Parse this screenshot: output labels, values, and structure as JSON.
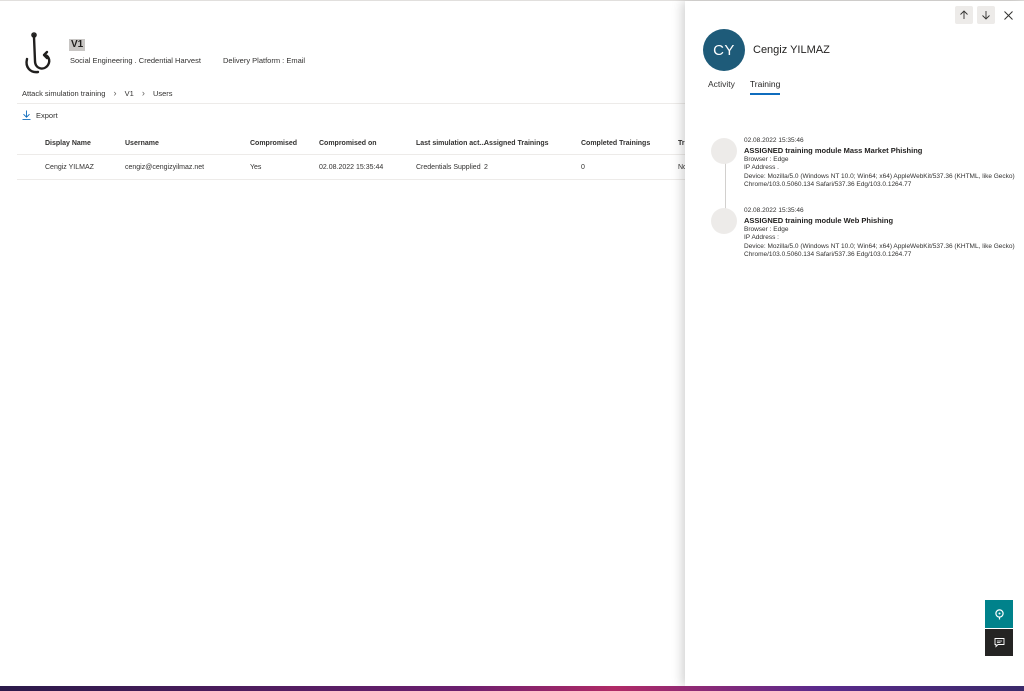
{
  "header": {
    "title": "V1",
    "technique": "Social Engineering . Credential Harvest",
    "platform": "Delivery Platform : Email",
    "logo_icon": "fishing-hook-icon"
  },
  "breadcrumb": [
    "Attack simulation training",
    "V1",
    "Users"
  ],
  "toolbar": {
    "export_label": "Export"
  },
  "table": {
    "columns": [
      "Display Name",
      "Username",
      "Compromised",
      "Compromised on",
      "Last simulation act...",
      "Assigned Trainings",
      "Completed Trainings",
      "Tr"
    ],
    "rows": [
      [
        "Cengiz YILMAZ",
        "cengiz@cengizyilmaz.net",
        "Yes",
        "02.08.2022 15:35:44",
        "Credentials Supplied",
        "2",
        "0",
        "No"
      ]
    ]
  },
  "panel": {
    "avatar_initials": "CY",
    "user_name": "Cengiz YILMAZ",
    "tabs": [
      "Activity",
      "Training"
    ],
    "active_tab": "Training",
    "events": [
      {
        "timestamp": "02.08.2022 15:35:46",
        "title": "ASSIGNED training module Mass Market Phishing",
        "browser": "Browser : Edge",
        "ip": "IP Address .",
        "device": "Device: Mozilla/5.0 (Windows NT 10.0; Win64; x64) AppleWebKit/537.36 (KHTML, like Gecko) Chrome/103.0.5060.134 Safari/537.36 Edg/103.0.1264.77"
      },
      {
        "timestamp": "02.08.2022 15:35:46",
        "title": "ASSIGNED training module Web Phishing",
        "browser": "Browser : Edge",
        "ip": "IP Address :",
        "device": "Device: Mozilla/5.0 (Windows NT 10.0; Win64; x64) AppleWebKit/537.36 (KHTML, like Gecko) Chrome/103.0.5060.134 Safari/537.36 Edg/103.0.1264.77"
      }
    ]
  },
  "colors": {
    "avatar": "#1e5b79",
    "accent": "#0f6cbd",
    "help_button": "#00828b",
    "feedback_button": "#252423"
  }
}
